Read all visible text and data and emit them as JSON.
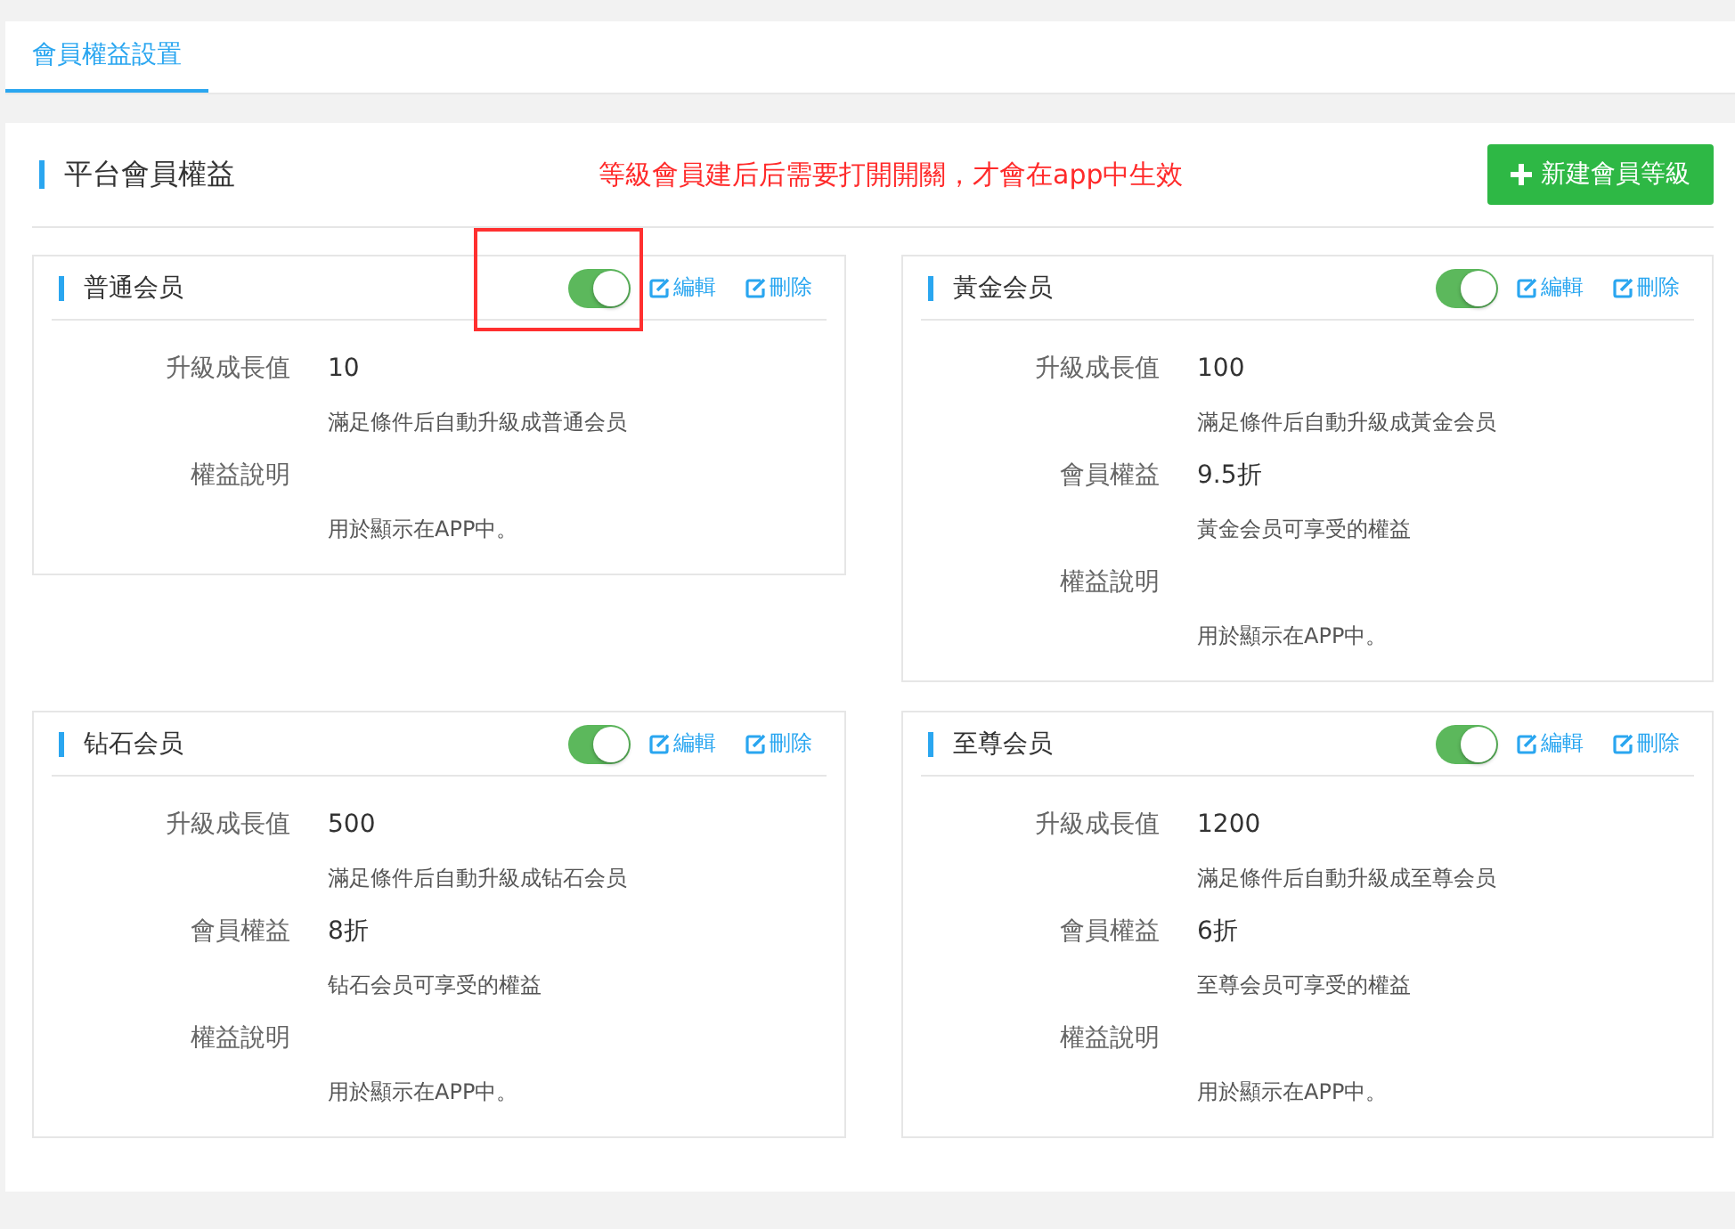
{
  "tabs": [
    {
      "label": "會員權益設置",
      "selected": true
    }
  ],
  "panel": {
    "title": "平台會員權益",
    "notice": "等級會員建后后需要打開開關，才會在app中生效",
    "add_button": "新建會員等級"
  },
  "levels": [
    {
      "name": "普通会员",
      "enabled": true,
      "highlighted": true,
      "edit": "編輯",
      "delete": "刪除",
      "fields": [
        {
          "label": "升級成長值",
          "value": "10",
          "hint": "滿足條件后自動升級成普通会员"
        },
        {
          "label": "權益說明",
          "hint": "用於顯示在APP中。"
        }
      ]
    },
    {
      "name": "黃金会员",
      "enabled": true,
      "highlighted": false,
      "edit": "編輯",
      "delete": "刪除",
      "fields": [
        {
          "label": "升級成長值",
          "value": "100",
          "hint": "滿足條件后自動升級成黃金会员"
        },
        {
          "label": "會員權益",
          "value": "9.5折",
          "hint": "黃金会员可享受的權益"
        },
        {
          "label": "權益說明",
          "hint": "用於顯示在APP中。"
        }
      ]
    },
    {
      "name": "钻石会员",
      "enabled": true,
      "highlighted": false,
      "edit": "編輯",
      "delete": "刪除",
      "fields": [
        {
          "label": "升級成長值",
          "value": "500",
          "hint": "滿足條件后自動升級成钻石会员"
        },
        {
          "label": "會員權益",
          "value": "8折",
          "hint": "钻石会员可享受的權益"
        },
        {
          "label": "權益說明",
          "hint": "用於顯示在APP中。"
        }
      ]
    },
    {
      "name": "至尊会员",
      "enabled": true,
      "highlighted": false,
      "edit": "編輯",
      "delete": "刪除",
      "fields": [
        {
          "label": "升級成長值",
          "value": "1200",
          "hint": "滿足條件后自動升級成至尊会员"
        },
        {
          "label": "會員權益",
          "value": "6折",
          "hint": "至尊会员可享受的權益"
        },
        {
          "label": "權益說明",
          "hint": "用於顯示在APP中。"
        }
      ]
    }
  ]
}
